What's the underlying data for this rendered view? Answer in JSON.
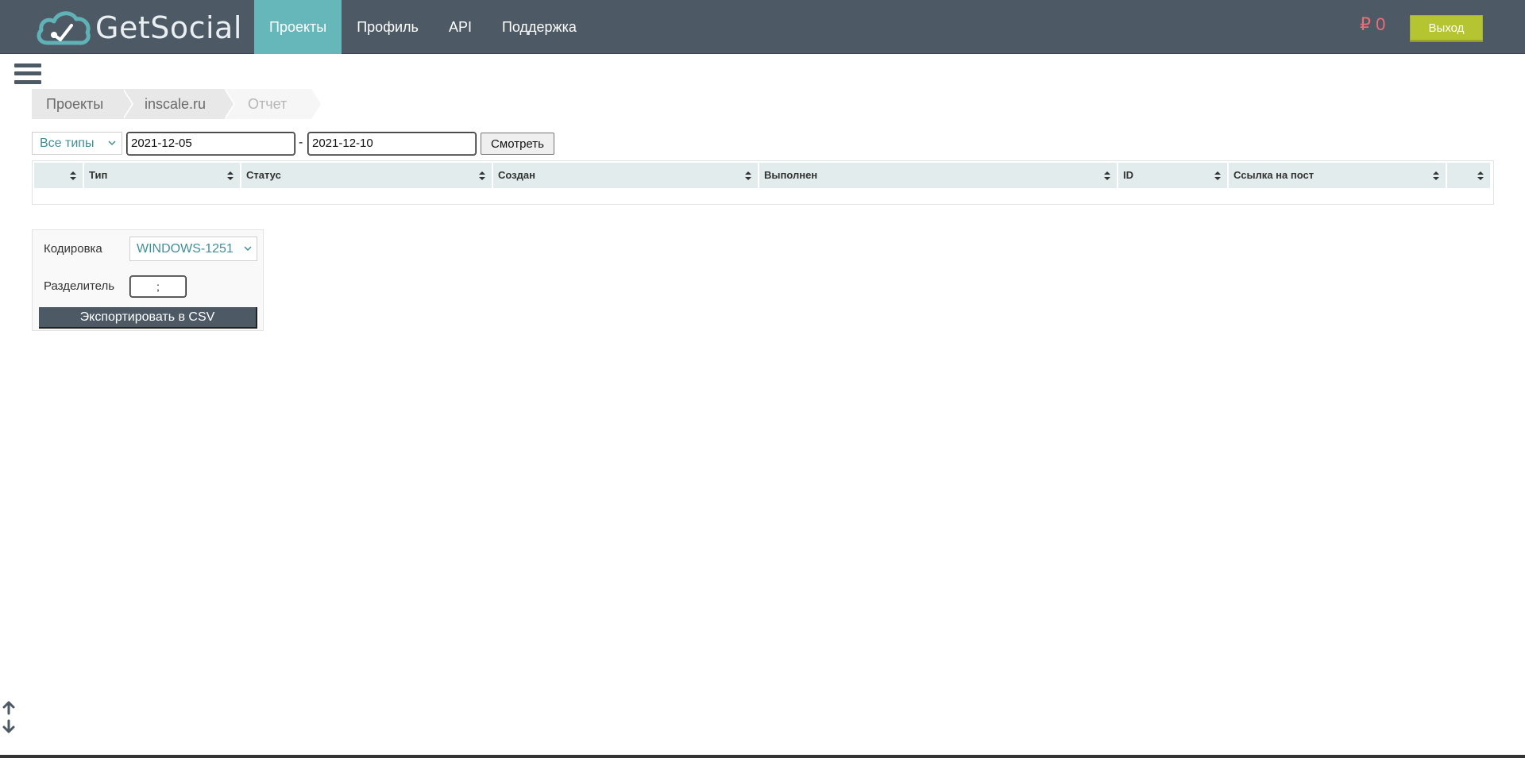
{
  "brand": {
    "name": "GetSocial",
    "colors": {
      "navbar": "#4d5a65",
      "active_tab": "#66b7ba",
      "balance": "#e86e7a",
      "logout": "#b5c531",
      "accent_text": "#3f8f96"
    }
  },
  "nav": {
    "items": [
      {
        "label": "Проекты",
        "active": true
      },
      {
        "label": "Профиль",
        "active": false
      },
      {
        "label": "API",
        "active": false
      },
      {
        "label": "Поддержка",
        "active": false
      }
    ],
    "balance": "₽ 0",
    "logout_label": "Выход"
  },
  "breadcrumb": {
    "items": [
      "Проекты",
      "inscale.ru",
      "Отчет"
    ]
  },
  "filters": {
    "type_select": "Все типы",
    "date_from": "2021-12-05",
    "date_separator": "-",
    "date_to": "2021-12-10",
    "view_button": "Смотреть"
  },
  "table": {
    "columns": [
      "",
      "Тип",
      "Статус",
      "Создан",
      "Выполнен",
      "ID",
      "Ссылка на пост",
      ""
    ],
    "rows": []
  },
  "export": {
    "encoding_label": "Кодировка",
    "encoding_value": "WINDOWS-1251",
    "separator_label": "Разделитель",
    "separator_value": ";",
    "export_button": "Экспортировать в CSV"
  },
  "icons": {
    "logo": "cloud-check-icon",
    "menu": "hamburger-menu-icon",
    "sort": "sort-icon",
    "chevron": "chevron-down-icon",
    "scroll_up": "arrow-up-icon",
    "scroll_down": "arrow-down-icon"
  }
}
